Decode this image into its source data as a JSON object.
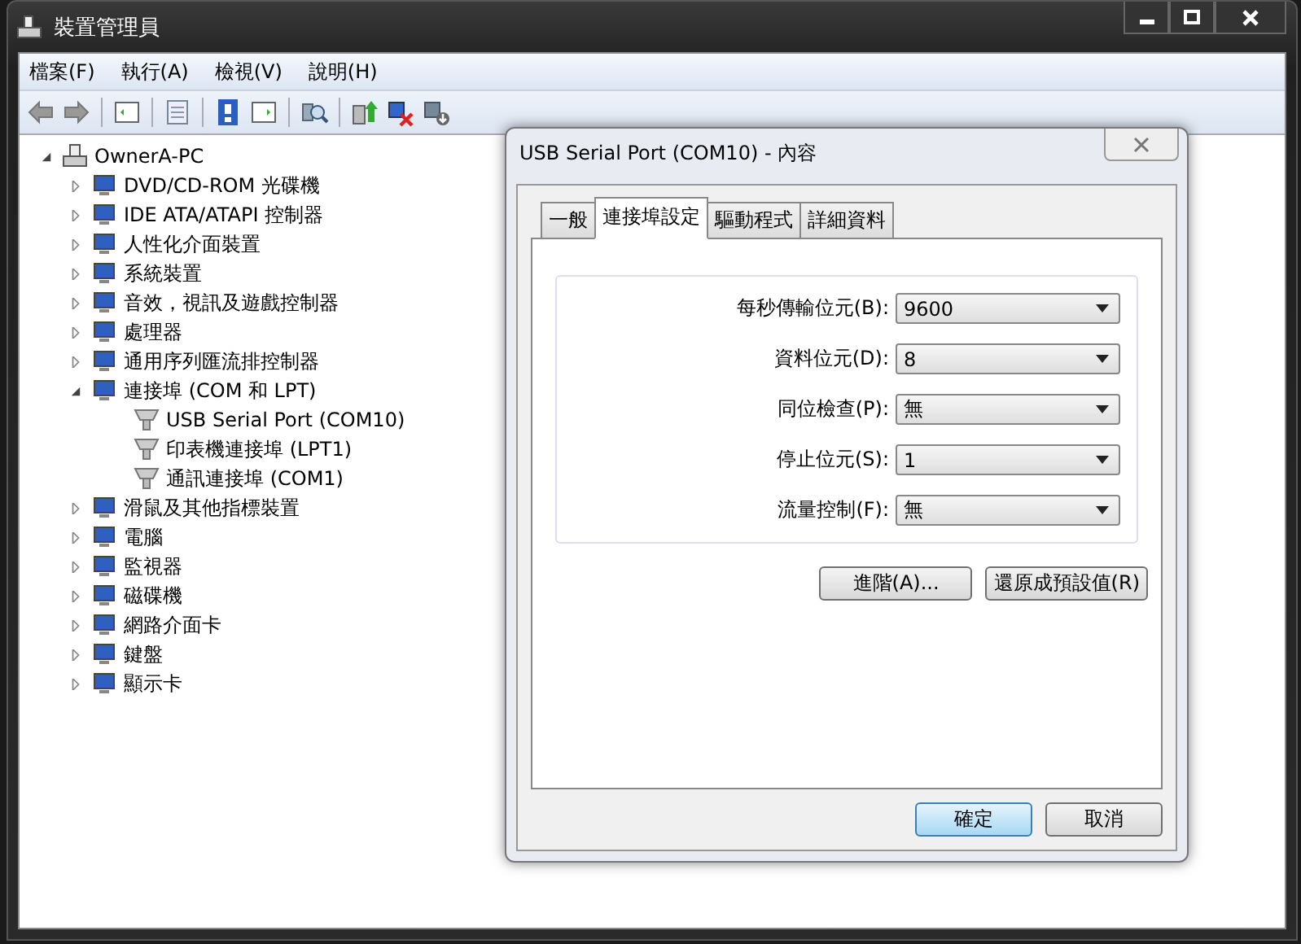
{
  "window": {
    "title": "裝置管理員"
  },
  "menu": [
    "檔案(F)",
    "執行(A)",
    "檢視(V)",
    "說明(H)"
  ],
  "tree": {
    "label": "OwnerA-PC",
    "expanded": true,
    "children": [
      {
        "label": "DVD/CD-ROM 光碟機",
        "expanded": false
      },
      {
        "label": "IDE ATA/ATAPI 控制器",
        "expanded": false
      },
      {
        "label": "人性化介面裝置",
        "expanded": false
      },
      {
        "label": "系統裝置",
        "expanded": false
      },
      {
        "label": "音效，視訊及遊戲控制器",
        "expanded": false
      },
      {
        "label": "處理器",
        "expanded": false
      },
      {
        "label": "通用序列匯流排控制器",
        "expanded": false
      },
      {
        "label": "連接埠 (COM 和 LPT)",
        "expanded": true,
        "children": [
          {
            "label": "USB Serial Port (COM10)"
          },
          {
            "label": "印表機連接埠 (LPT1)"
          },
          {
            "label": "通訊連接埠 (COM1)"
          }
        ]
      },
      {
        "label": "滑鼠及其他指標裝置",
        "expanded": false
      },
      {
        "label": "電腦",
        "expanded": false
      },
      {
        "label": "監視器",
        "expanded": false
      },
      {
        "label": "磁碟機",
        "expanded": false
      },
      {
        "label": "網路介面卡",
        "expanded": false
      },
      {
        "label": "鍵盤",
        "expanded": false
      },
      {
        "label": "顯示卡",
        "expanded": false
      }
    ]
  },
  "dialog": {
    "title": "USB Serial Port (COM10) - 內容",
    "tabs": [
      {
        "label": "一般",
        "selected": false
      },
      {
        "label": "連接埠設定",
        "selected": true
      },
      {
        "label": "驅動程式",
        "selected": false
      },
      {
        "label": "詳細資料",
        "selected": false
      }
    ],
    "fields": [
      {
        "label": "每秒傳輸位元(B):",
        "value": "9600"
      },
      {
        "label": "資料位元(D):",
        "value": "8"
      },
      {
        "label": "同位檢查(P):",
        "value": "無"
      },
      {
        "label": "停止位元(S):",
        "value": "1"
      },
      {
        "label": "流量控制(F):",
        "value": "無"
      }
    ],
    "buttons": [
      "進階(A)...",
      "還原成預設值(R)"
    ],
    "footer_buttons": [
      {
        "label": "確定",
        "default": true
      },
      {
        "label": "取消",
        "default": false
      }
    ]
  }
}
